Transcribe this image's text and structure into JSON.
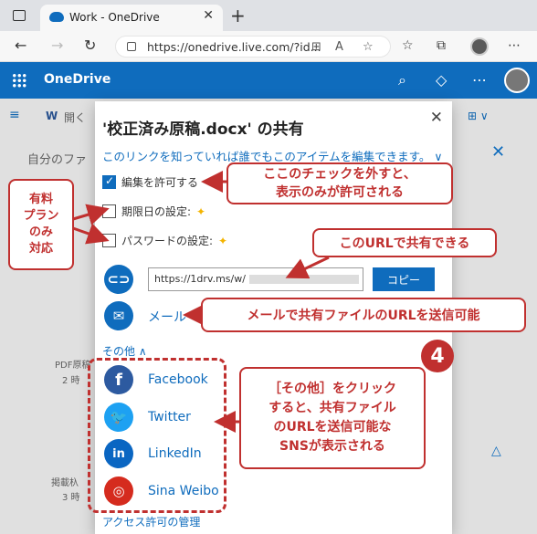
{
  "browser": {
    "tab_title": "Work - OneDrive",
    "tab_close": "✕",
    "new_tab": "+",
    "url": "https://onedrive.live.com/?id...",
    "back": "←",
    "forward": "→",
    "reload": "↻"
  },
  "app": {
    "title": "OneDrive"
  },
  "background": {
    "toolbar_open": "開く",
    "your_files": "自分のファ",
    "file1_name": "PDF原稿",
    "file1_time": "2 時",
    "file2_name": "掲載杁",
    "file2_time": "3 時"
  },
  "dialog": {
    "title": "'校正済み原稿.docx' の共有",
    "close": "✕",
    "link_info": "このリンクを知っていれば誰でもこのアイテムを編集できます。",
    "link_info_chevron": "∨",
    "allow_edit": "編集を許可する",
    "expiry": "期限日の設定:",
    "password": "パスワードの設定:",
    "premium_mark": "✦",
    "url_value": "https://1drv.ms/w/",
    "copy_button": "コピー",
    "mail": "メール",
    "more": "その他",
    "sns": [
      "Facebook",
      "Twitter",
      "LinkedIn",
      "Sina Weibo"
    ],
    "access": "アクセス許可の管理"
  },
  "callouts": {
    "paid_plan": "有料\nプラン\nのみ\n対応",
    "checkbox": "ここのチェックを外すと、\n表示のみが許可される",
    "url_share": "このURLで共有できる",
    "mail_share": "メールで共有ファイルのURLを送信可能",
    "sns_share": "［その他］をクリック\nすると、共有ファイル\nのURLを送信可能な\nSNSが表示される",
    "badge": "4"
  },
  "colors": {
    "accent": "#0f6cbd",
    "callout_red": "#c0302f",
    "facebook": "#2d5aa0",
    "twitter": "#1da1f2",
    "linkedin": "#0a66c2",
    "weibo": "#d52b1e"
  }
}
